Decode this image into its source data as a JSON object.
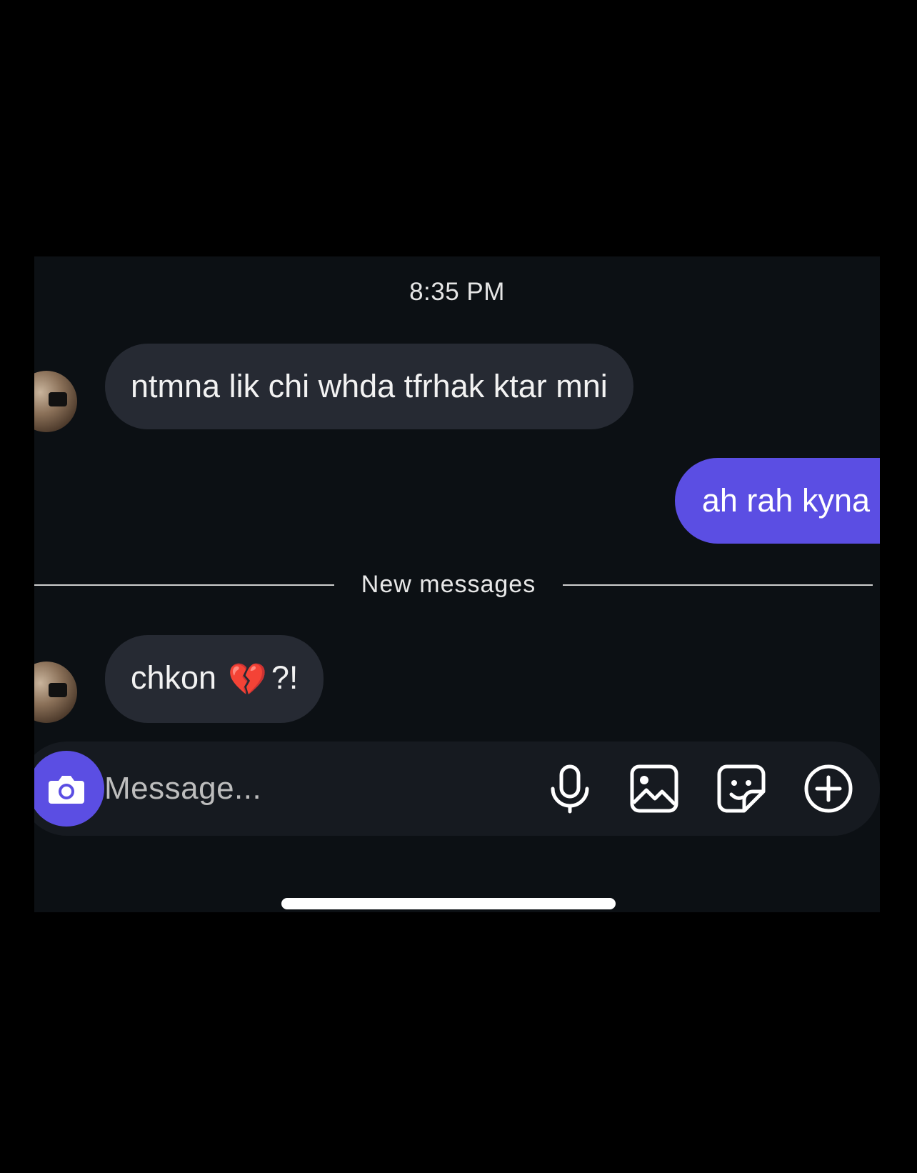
{
  "chat": {
    "timestamp": "8:35 PM",
    "messages": [
      {
        "direction": "incoming",
        "text": "ntmna lik chi whda tfrhak ktar mni"
      },
      {
        "direction": "outgoing",
        "text": "ah rah kyna"
      }
    ],
    "new_messages_label": "New messages",
    "latest_message": {
      "direction": "incoming",
      "text": "chkon",
      "emoji": "💔",
      "suffix": "?!"
    }
  },
  "composer": {
    "placeholder": "Message...",
    "icons": [
      "camera-icon",
      "microphone-icon",
      "gallery-icon",
      "sticker-icon",
      "add-icon"
    ]
  },
  "colors": {
    "background": "#0c1014",
    "incoming_bubble": "#262a33",
    "outgoing_bubble": "#5b4ee3",
    "accent": "#5b4ee3"
  }
}
